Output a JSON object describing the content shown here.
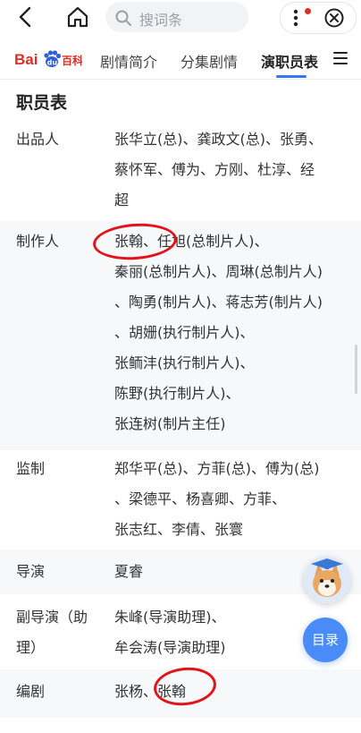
{
  "topbar": {
    "search_placeholder": "搜词条"
  },
  "tabs": {
    "logo_text_left": "Bai",
    "logo_text_right": "百科",
    "items": [
      "剧情简介",
      "分集剧情",
      "演职员表"
    ],
    "active_index": 2
  },
  "section": {
    "title": "职员表"
  },
  "rows": [
    {
      "label": [
        "出品人"
      ],
      "value": [
        "张华立(总)、龚政文(总)、张勇、",
        "蔡怀军、傅为、方刚、杜淳、经",
        "超"
      ]
    },
    {
      "label": [
        "制作人"
      ],
      "value": [
        "张翰、任旭(总制片人)、",
        "秦丽(总制片人)、周琳(总制片人)",
        "、陶勇(制片人)、蒋志芳(制片人)",
        "、胡姗(执行制片人)、",
        "张鲕沣(执行制片人)、",
        "陈野(执行制片人)、",
        "张连树(制片主任)"
      ]
    },
    {
      "label": [
        "监制"
      ],
      "value": [
        "郑华平(总)、方菲(总)、傅为(总)",
        "、梁德平、杨喜卿、方菲、",
        "张志红、李倩、张寰"
      ]
    },
    {
      "label": [
        "导演"
      ],
      "value": [
        "夏睿"
      ]
    },
    {
      "label": [
        "副导演（助",
        "理）"
      ],
      "value": [
        "朱峰(导演助理)、",
        "牟会涛(导演助理)"
      ]
    },
    {
      "label": [
        "编剧"
      ],
      "value": [
        "张杨、张翰"
      ]
    }
  ],
  "floating": {
    "toc_label": "目录"
  },
  "colors": {
    "accent": "#3476f6",
    "annotation": "#e3131a",
    "toc_bg": "#4a8cf7"
  }
}
